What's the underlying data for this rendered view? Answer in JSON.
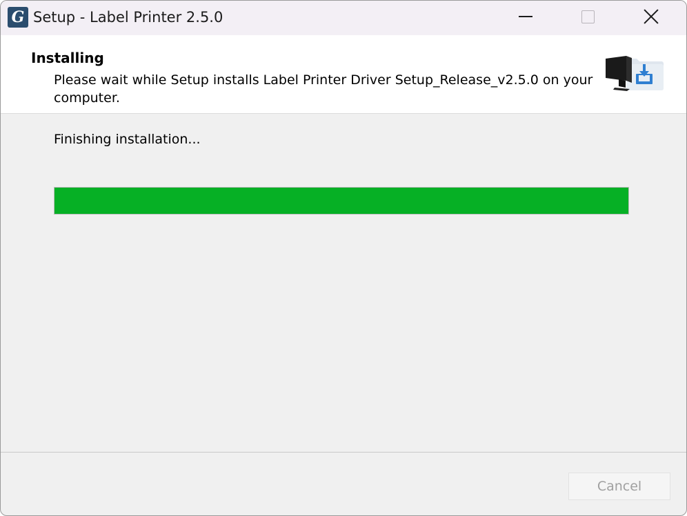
{
  "window": {
    "title": "Setup - Label Printer 2.5.0",
    "app_icon_glyph": "G"
  },
  "header": {
    "title": "Installing",
    "description": "Please wait while Setup installs Label Printer Driver Setup_Release_v2.5.0 on your computer.",
    "icon": "install-monitor-folder-icon"
  },
  "content": {
    "status": "Finishing installation...",
    "progress_fraction": 1.0,
    "progress_color": "#06b025"
  },
  "footer": {
    "cancel_label": "Cancel",
    "cancel_enabled": false
  },
  "icons": {
    "minimize": "minimize-icon",
    "maximize": "maximize-icon",
    "close": "close-icon"
  }
}
